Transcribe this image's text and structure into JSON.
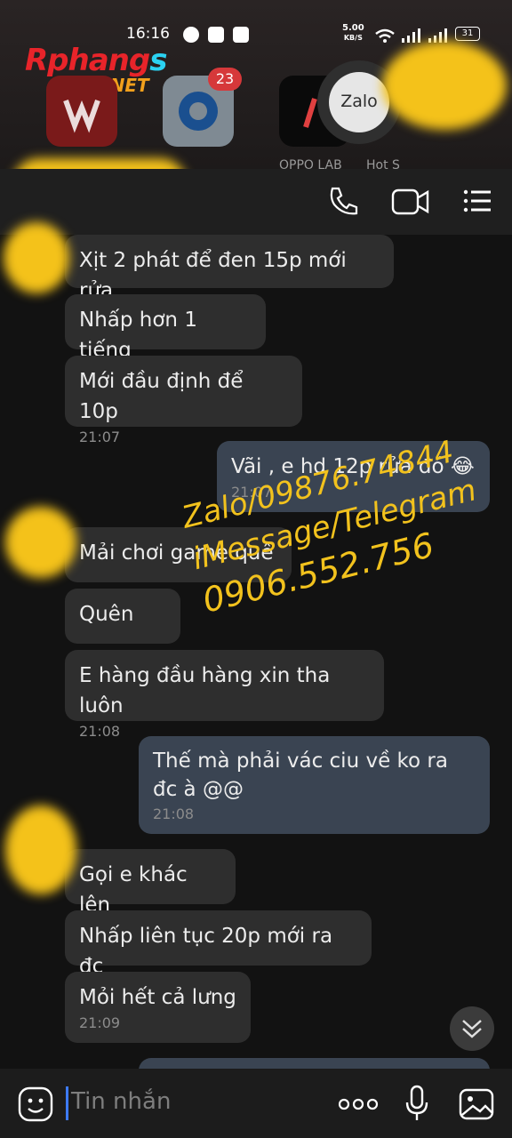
{
  "status_bar": {
    "time": "16:16",
    "speed": "5.00",
    "speed_unit": "KB/S",
    "battery": "31"
  },
  "logo": {
    "name_main": "Rphang",
    "name_s": "s",
    "suffix": ".NET"
  },
  "launcher": {
    "badge_count": "23",
    "zalo_label": "Zalo",
    "app_label_oppo": "OPPO LAB",
    "app_label_hot": "Hot S"
  },
  "messages": [
    {
      "text": "Xịt 2 phát để đen 15p mới rửa",
      "time": "",
      "from": "other"
    },
    {
      "text": "Nhấp hơn 1 tiếng",
      "time": "",
      "from": "other"
    },
    {
      "text": "Mới đầu định để 10p",
      "time": "21:07",
      "from": "other"
    },
    {
      "text": "Vãi , e hd 12p rửa đó 😂",
      "time": "21:07",
      "from": "me"
    },
    {
      "text": "Mải chơi game quê",
      "time": "",
      "from": "other"
    },
    {
      "text": "Quên",
      "time": "",
      "from": "other"
    },
    {
      "text": "E hàng đầu hàng xin tha luôn",
      "time": "21:08",
      "from": "other"
    },
    {
      "text": "Thế mà phải vác ciu về ko ra đc à @@",
      "time": "21:08",
      "from": "me"
    },
    {
      "text": "Gọi e khác lên",
      "time": "",
      "from": "other"
    },
    {
      "text": "Nhấp liên tục 20p mới ra đc",
      "time": "",
      "from": "other"
    },
    {
      "text": "Mỏi hết cả lưng",
      "time": "21:09",
      "from": "other"
    }
  ],
  "watermark": {
    "line1": "Zalo/09876.74844",
    "line2": "iMessage/Telegram",
    "line3": "0906.552.756"
  },
  "input": {
    "placeholder": "Tin nhắn"
  },
  "icons": [
    "phone-icon",
    "video-call-icon",
    "menu-icon",
    "emoji-icon",
    "more-icon",
    "microphone-icon",
    "image-icon",
    "scroll-down-icon"
  ],
  "colors": {
    "background": "#121212",
    "bubble_other": "#2e2e2e",
    "bubble_me": "#3a4452",
    "watermark": "#f2c21d"
  }
}
